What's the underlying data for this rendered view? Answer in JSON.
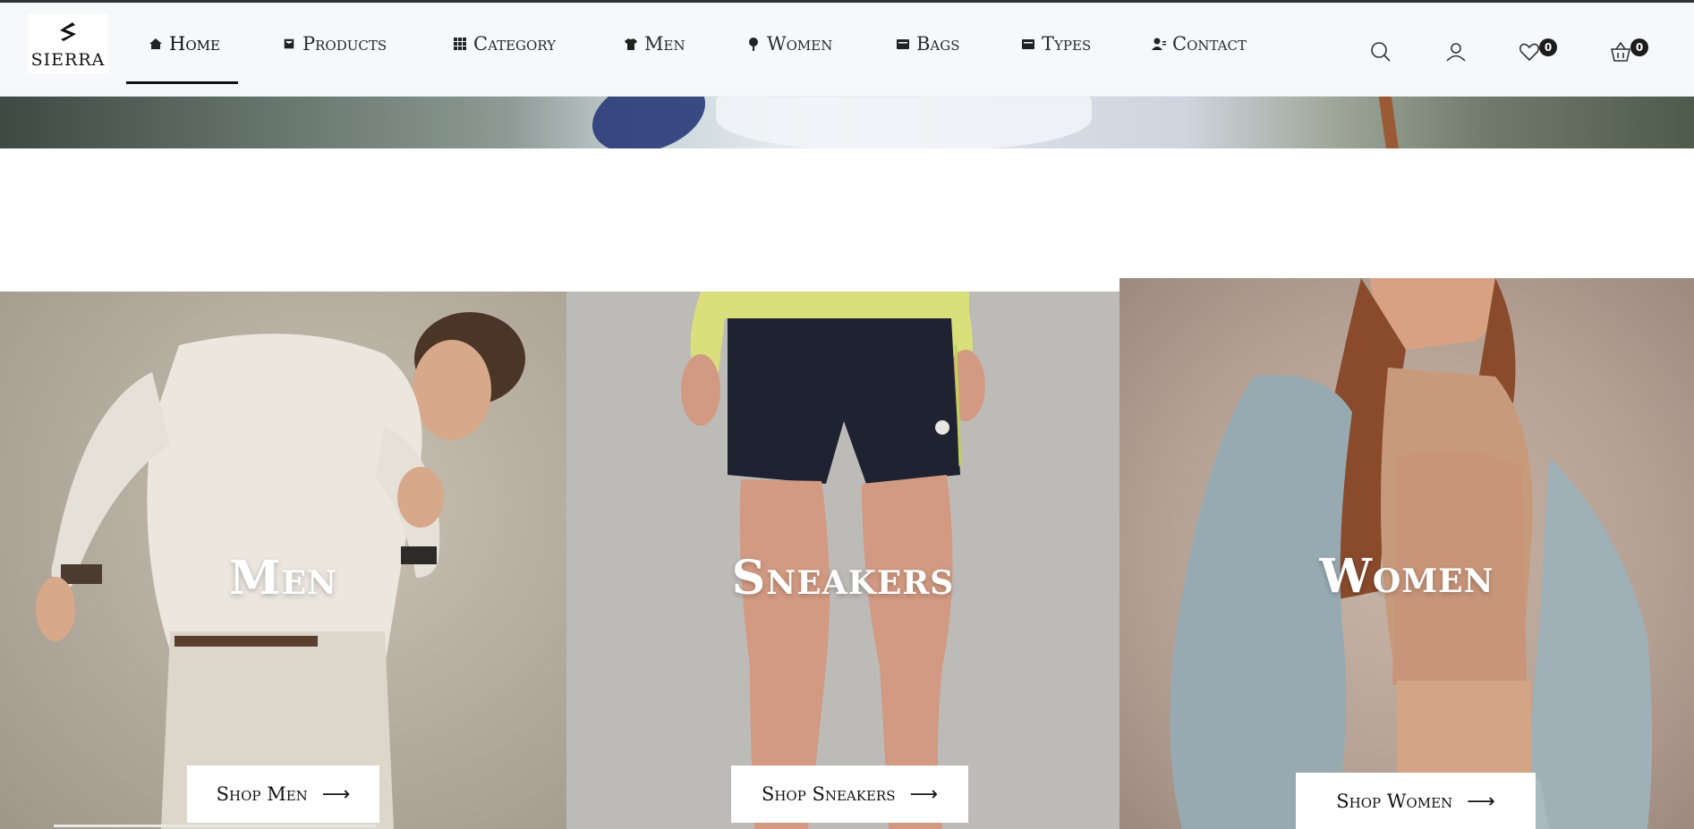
{
  "brand": {
    "logo_text": "SIERRA"
  },
  "nav": {
    "items": [
      {
        "label": "Home",
        "icon": "home-icon",
        "active": true
      },
      {
        "label": "Products",
        "icon": "bag-icon",
        "active": false
      },
      {
        "label": "Category",
        "icon": "grid-icon",
        "active": false
      },
      {
        "label": "Men",
        "icon": "shirt-icon",
        "active": false
      },
      {
        "label": "Women",
        "icon": "female-icon",
        "active": false
      },
      {
        "label": "Bags",
        "icon": "wallet-icon",
        "active": false
      },
      {
        "label": "Types",
        "icon": "wallet-icon",
        "active": false
      },
      {
        "label": "Contact",
        "icon": "contact-icon",
        "active": false
      }
    ]
  },
  "utilities": {
    "wishlist_count": "0",
    "cart_count": "0"
  },
  "panels": {
    "men": {
      "title": "Men",
      "button": "Shop Men"
    },
    "sneakers": {
      "title": "Sneakers",
      "button": "Shop Sneakers"
    },
    "women": {
      "title": "Women",
      "button": "Shop Women"
    }
  },
  "colors": {
    "navbar_bg": "#f7f8fa",
    "accent_dark": "#1d1d1d",
    "panel_men_bg": "#b2aa9c",
    "panel_sneakers_bg": "#bdbbb8",
    "panel_women_bg": "#b5a194"
  }
}
